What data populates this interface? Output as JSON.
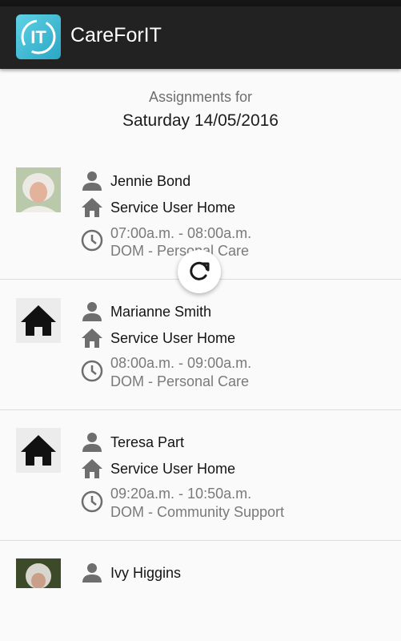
{
  "app": {
    "title": "CareForIT",
    "logo_text": "IT"
  },
  "header": {
    "subtitle": "Assignments for",
    "date": "Saturday 14/05/2016"
  },
  "assignments": [
    {
      "name": "Jennie Bond",
      "location": "Service User Home",
      "time": "07:00a.m. - 08:00a.m.",
      "service": "DOM - Personal Care",
      "thumb": "photo"
    },
    {
      "name": "Marianne Smith",
      "location": "Service User Home",
      "time": "08:00a.m. - 09:00a.m.",
      "service": "DOM - Personal Care",
      "thumb": "home-icon"
    },
    {
      "name": "Teresa Part",
      "location": "Service User Home",
      "time": "09:20a.m. - 10:50a.m.",
      "service": "DOM - Community Support",
      "thumb": "home-icon"
    },
    {
      "name": "Ivy Higgins",
      "thumb": "photo"
    }
  ],
  "colors": {
    "appbar": "#222222",
    "logo": "#3bbcd6",
    "icon_gray": "#6e6e6e"
  },
  "icons": [
    "person-icon",
    "home-icon",
    "clock-icon",
    "refresh-icon"
  ]
}
